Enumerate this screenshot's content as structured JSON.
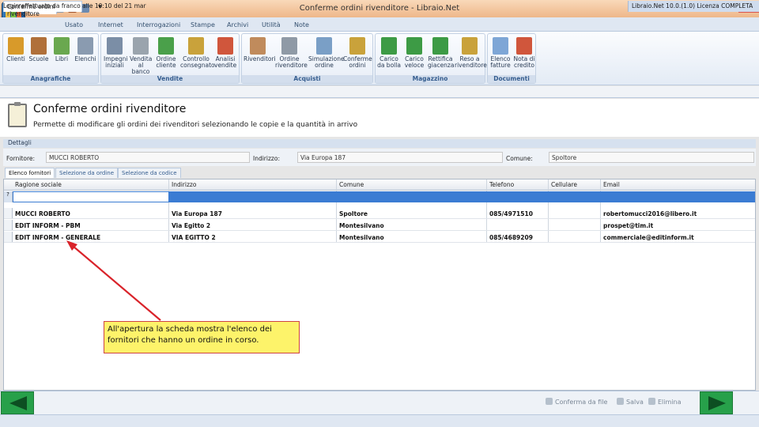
{
  "window": {
    "title": "Conferme ordini rivenditore - Libraio.Net",
    "minimize": "_",
    "restore": "▫",
    "close": "✕",
    "pin": "⊼",
    "quick_access_dropdown": "▾"
  },
  "ribbon": {
    "tabs": [
      "Base",
      "Usato",
      "Internet",
      "Interrogazioni",
      "Stampe",
      "Archivi",
      "Utilità",
      "Note"
    ],
    "groups": [
      {
        "label": "Anagrafiche",
        "buttons": [
          {
            "label": "Clienti",
            "icon": "people-icon",
            "color": "#d89a2a"
          },
          {
            "label": "Scuole",
            "icon": "school-icon",
            "color": "#b0703a"
          },
          {
            "label": "Libri",
            "icon": "books-icon",
            "color": "#6aa84f"
          },
          {
            "label": "Elenchi",
            "icon": "list-icon",
            "color": "#8a9bb0"
          }
        ]
      },
      {
        "label": "Vendite",
        "buttons": [
          {
            "label": "Impegni iniziali",
            "icon": "calculator-icon",
            "color": "#7b8ea6"
          },
          {
            "label": "Vendita al banco",
            "icon": "cash-register-icon",
            "color": "#9aa4ad"
          },
          {
            "label": "Ordine cliente",
            "icon": "basket-icon",
            "color": "#4aa04a"
          },
          {
            "label": "Controllo consegnato",
            "icon": "books-check-icon",
            "color": "#c9a23b"
          },
          {
            "label": "Analisi vendite",
            "icon": "chart-icon",
            "color": "#d0563c"
          }
        ]
      },
      {
        "label": "Acquisti",
        "buttons": [
          {
            "label": "Rivenditori",
            "icon": "person-icon",
            "color": "#c08b5c"
          },
          {
            "label": "Ordine rivenditore",
            "icon": "clipboard-icon",
            "color": "#8f9aa6"
          },
          {
            "label": "Simulazione ordine",
            "icon": "clipboard-search-icon",
            "color": "#7a9fc6"
          },
          {
            "label": "Conferme ordini",
            "icon": "clipboard-pencil-icon",
            "color": "#c9a23b"
          }
        ]
      },
      {
        "label": "Magazzino",
        "buttons": [
          {
            "label": "Carico da bolla",
            "icon": "book-up-icon",
            "color": "#3d9b45"
          },
          {
            "label": "Carico veloce",
            "icon": "book-fast-icon",
            "color": "#3d9b45"
          },
          {
            "label": "Rettifica giacenza",
            "icon": "books-edit-icon",
            "color": "#3d9b45"
          },
          {
            "label": "Reso a rivenditore",
            "icon": "books-return-icon",
            "color": "#c9a23b"
          }
        ]
      },
      {
        "label": "Documenti",
        "buttons": [
          {
            "label": "Elenco fatture",
            "icon": "document-icon",
            "color": "#7ea6d6"
          },
          {
            "label": "Nota di credito",
            "icon": "document-pen-icon",
            "color": "#d0563c"
          }
        ]
      }
    ]
  },
  "document_tab": {
    "label": "Conferme ordini rivenditore",
    "close": "×"
  },
  "header": {
    "title": "Conferme ordini rivenditore",
    "subtitle": "Permette di modificare gli ordini dei rivenditori selezionando le copie e la quantità in arrivo"
  },
  "details": {
    "section_label": "Dettagli",
    "fornitore_label": "Fornitore:",
    "fornitore_value": "MUCCI ROBERTO",
    "indirizzo_label": "Indirizzo:",
    "indirizzo_value": "Via Europa 187",
    "comune_label": "Comune:",
    "comune_value": "Spoltore"
  },
  "inner_tabs": [
    "Elenco fornitori",
    "Selezione da ordine",
    "Selezione da codice"
  ],
  "grid": {
    "columns": [
      "Ragione sociale",
      "Indirizzo",
      "Comune",
      "Telefono",
      "Cellulare",
      "Email"
    ],
    "filter_marker": "?",
    "rows": [
      {
        "ragione": "MUCCI ROBERTO",
        "indirizzo": "Via Europa 187",
        "comune": "Spoltore",
        "telefono": "085/4971510",
        "cellulare": "",
        "email": "robertomucci2016@libero.it"
      },
      {
        "ragione": "EDIT INFORM - PBM",
        "indirizzo": "Via Egitto 2",
        "comune": "Montesilvano",
        "telefono": "",
        "cellulare": "",
        "email": "prospet@tim.it"
      },
      {
        "ragione": "EDIT INFORM - GENERALE",
        "indirizzo": "VIA EGITTO 2",
        "comune": "Montesilvano",
        "telefono": "085/4689209",
        "cellulare": "",
        "email": "commerciale@editinform.it"
      }
    ]
  },
  "annotation": {
    "text": "All'apertura la scheda mostra l'elenco dei fornitori che hanno un ordine in corso.",
    "arrow_color": "#d9232a"
  },
  "actions": {
    "conferma": "Conferma da file",
    "salva": "Salva",
    "elimina": "Elimina"
  },
  "nav": {
    "back_color": "#27a04a",
    "forward_color": "#27a04a"
  },
  "status": {
    "left": "Login effettuato da franco alle 10:10 del 21 mar",
    "right": "Libraio.Net 10.0.(1.0) Licenza COMPLETA"
  }
}
